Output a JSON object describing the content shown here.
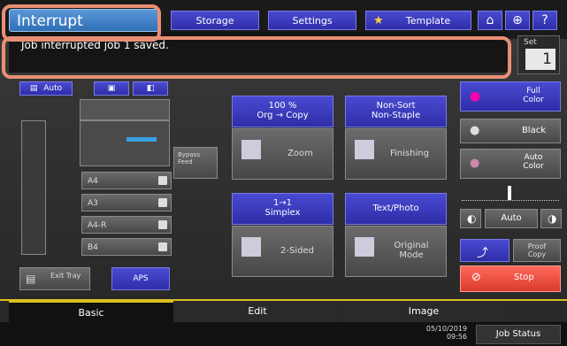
{
  "header": {
    "title": "Interrupt",
    "tabs": [
      "Storage",
      "Settings",
      "Template"
    ],
    "icons": [
      "home-icon",
      "globe-icon",
      "help-icon"
    ]
  },
  "message": {
    "text": "Job interrupted job 1 saved."
  },
  "set_counter": {
    "label": "Set",
    "value": "1"
  },
  "left_panel": {
    "auto_label": "Auto",
    "bypass_label": "Bypass Feed",
    "trays": [
      "A4",
      "A3",
      "A4-R",
      "B4"
    ],
    "exit_tray_label": "Exit Tray",
    "aps_label": "APS"
  },
  "center": {
    "zoom_info": "100 %",
    "zoom_info2": "Org → Copy",
    "zoom_button": "Zoom",
    "finishing_info": "Non-Sort Non-Staple",
    "finishing_button": "Finishing",
    "sided_info": "1→1 Simplex",
    "sided_button": "2-Sided",
    "mode_info": "Text/Photo",
    "mode_button": "Original Mode"
  },
  "right_panel": {
    "full_color": "Full Color",
    "black": "Black",
    "auto_color": "Auto Color",
    "density_auto": "Auto",
    "proof_copy": "Proof Copy",
    "stop": "Stop"
  },
  "bottom_tabs": [
    "Basic",
    "Edit",
    "Image"
  ],
  "status": {
    "date": "05/10/2019",
    "time": "09:56",
    "job_status": "Job Status"
  },
  "colors": {
    "accent_blue": "#3a3ac0",
    "title_blue": "#4a88cc",
    "stop_red": "#e25555",
    "highlight": "#e98f75"
  }
}
